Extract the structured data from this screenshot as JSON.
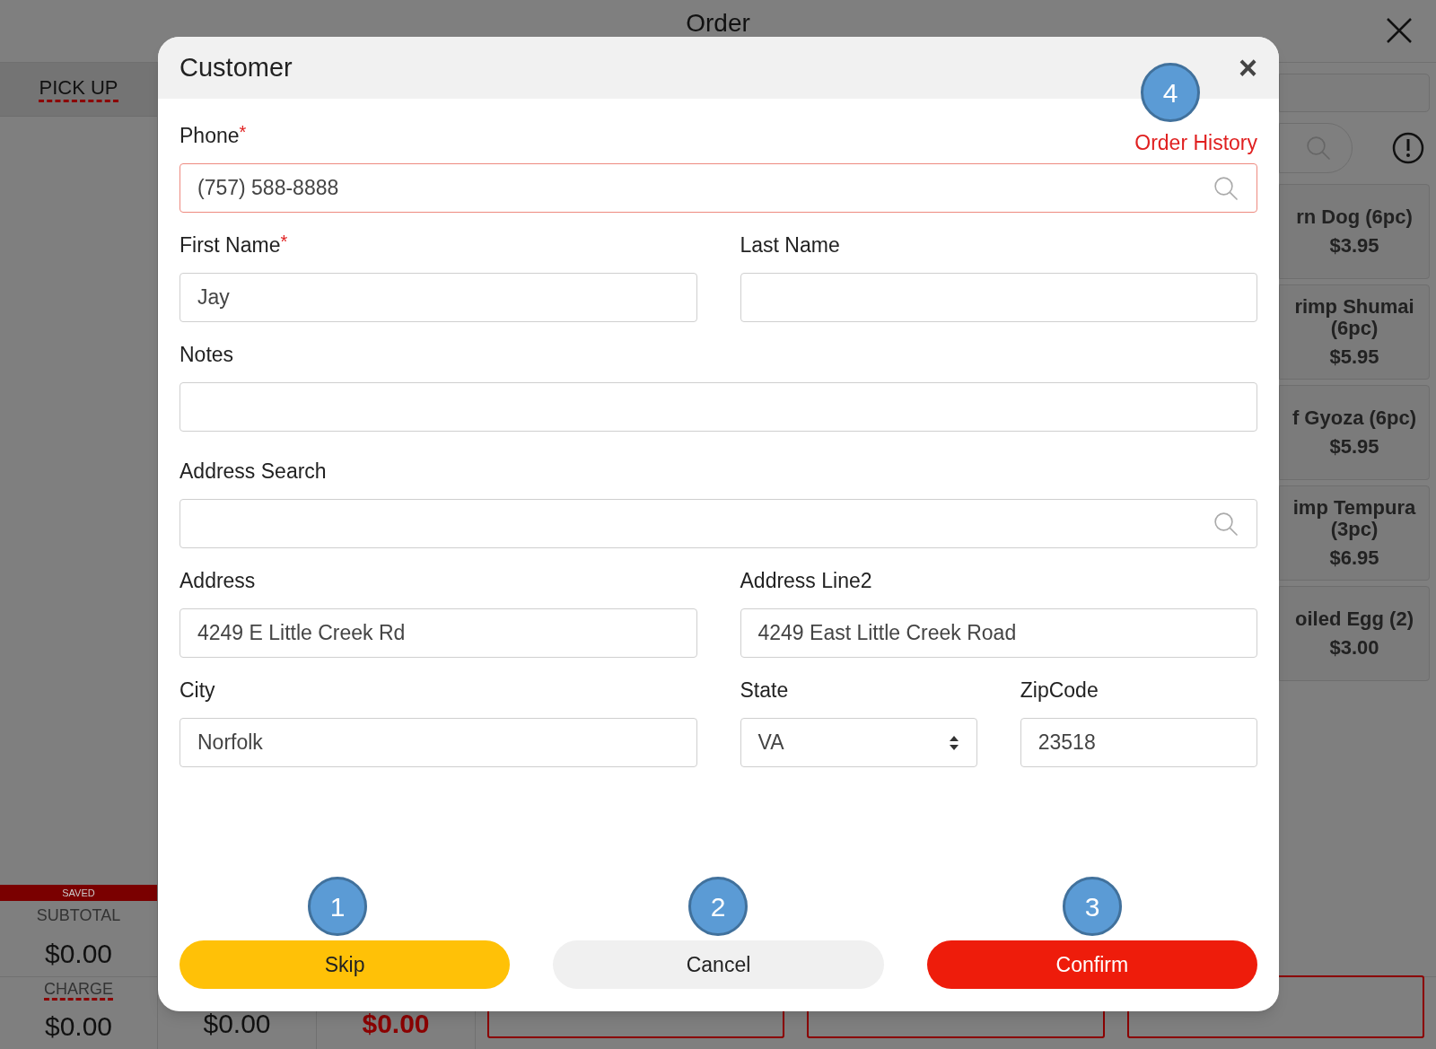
{
  "background": {
    "title": "Order",
    "order_type": "PICK UP",
    "menu_items": [
      {
        "name": "rn Dog (6pc)",
        "price": "$3.95"
      },
      {
        "name": "rimp Shumai (6pc)",
        "price": "$5.95"
      },
      {
        "name": "f Gyoza (6pc)",
        "price": "$5.95"
      },
      {
        "name": "imp Tempura (3pc)",
        "price": "$6.95"
      },
      {
        "name": "oiled Egg (2)",
        "price": "$3.00"
      }
    ],
    "saved_label": "SAVED",
    "subtotal_label": "SUBTOTAL",
    "subtotal": "$0.00",
    "charge_label": "CHARGE",
    "charge": "$0.00",
    "totals": [
      {
        "value": "$0.00",
        "highlight": false
      },
      {
        "value": "$0.00",
        "highlight": true
      }
    ]
  },
  "dialog": {
    "title": "Customer",
    "close": "×",
    "order_history_link": "Order History",
    "rows": [
      [
        {
          "label": "Phone",
          "required_mark": "*",
          "kind": "search",
          "value": "(757) 588-8888",
          "invalid": true
        }
      ],
      [
        {
          "label": "First Name",
          "required_mark": "*",
          "kind": "text",
          "value": "Jay",
          "invalid": false
        },
        {
          "label": "Last Name",
          "kind": "text",
          "invalid": false
        }
      ],
      [
        {
          "label": "Notes",
          "kind": "text",
          "invalid": false
        }
      ],
      [
        {
          "label": "Address Search",
          "kind": "search",
          "invalid": false
        }
      ],
      [
        {
          "label": "Address",
          "kind": "text",
          "value": "4249 E Little Creek Rd",
          "invalid": false
        },
        {
          "label": "Address Line2",
          "kind": "text",
          "value": "4249 East Little Creek Road",
          "invalid": false
        }
      ],
      [
        {
          "label": "City",
          "kind": "text",
          "value": "Norfolk",
          "invalid": false
        },
        {
          "label": "State",
          "kind": "select",
          "value": "VA",
          "invalid": false
        },
        {
          "label": "ZipCode",
          "kind": "text",
          "value": "23518",
          "invalid": false
        }
      ]
    ],
    "buttons": [
      {
        "label": "Skip",
        "kind": "skip"
      },
      {
        "label": "Cancel",
        "kind": "cancel"
      },
      {
        "label": "Confirm",
        "kind": "confirm"
      }
    ]
  },
  "annotations": [
    "1",
    "2",
    "3",
    "4"
  ]
}
